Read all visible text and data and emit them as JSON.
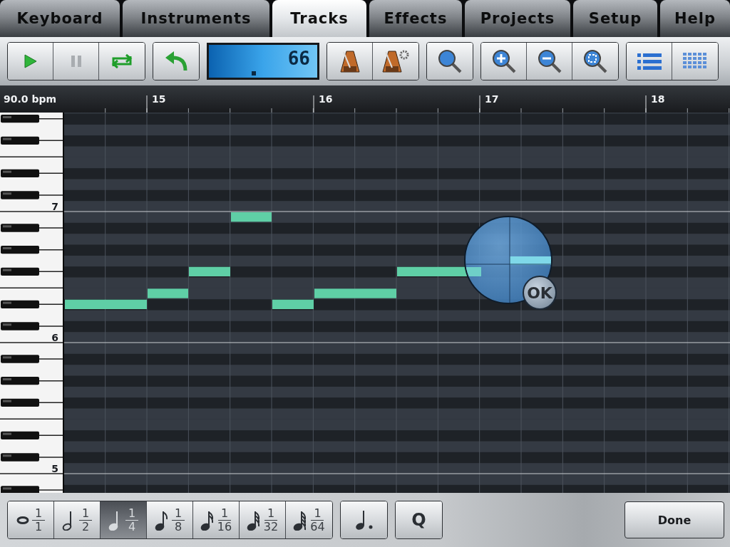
{
  "tabs": [
    {
      "label": "Keyboard",
      "selected": false
    },
    {
      "label": "Instruments",
      "selected": false
    },
    {
      "label": "Tracks",
      "selected": true
    },
    {
      "label": "Effects",
      "selected": false
    },
    {
      "label": "Projects",
      "selected": false
    },
    {
      "label": "Setup",
      "selected": false
    },
    {
      "label": "Help",
      "selected": false
    }
  ],
  "toolbar": {
    "tempo_display": "66"
  },
  "ruler": {
    "tempo": "90.0 bpm",
    "bars": [
      "15",
      "16",
      "17",
      "18"
    ]
  },
  "keyboard": {
    "octave_labels": [
      "7",
      "6",
      "5"
    ]
  },
  "loupe": {
    "button": "OK"
  },
  "note_values": [
    {
      "kind": "whole",
      "numerator": "1",
      "denominator": "1",
      "selected": false
    },
    {
      "kind": "half",
      "numerator": "1",
      "denominator": "2",
      "selected": false
    },
    {
      "kind": "quarter",
      "numerator": "1",
      "denominator": "4",
      "selected": true
    },
    {
      "kind": "eighth",
      "numerator": "1",
      "denominator": "8",
      "selected": false
    },
    {
      "kind": "sixteenth",
      "numerator": "1",
      "denominator": "16",
      "selected": false
    },
    {
      "kind": "thirty-second",
      "numerator": "1",
      "denominator": "32",
      "selected": false
    },
    {
      "kind": "sixty-fourth",
      "numerator": "1",
      "denominator": "64",
      "selected": false
    }
  ],
  "quantize_button": "Q",
  "done_button": "Done"
}
